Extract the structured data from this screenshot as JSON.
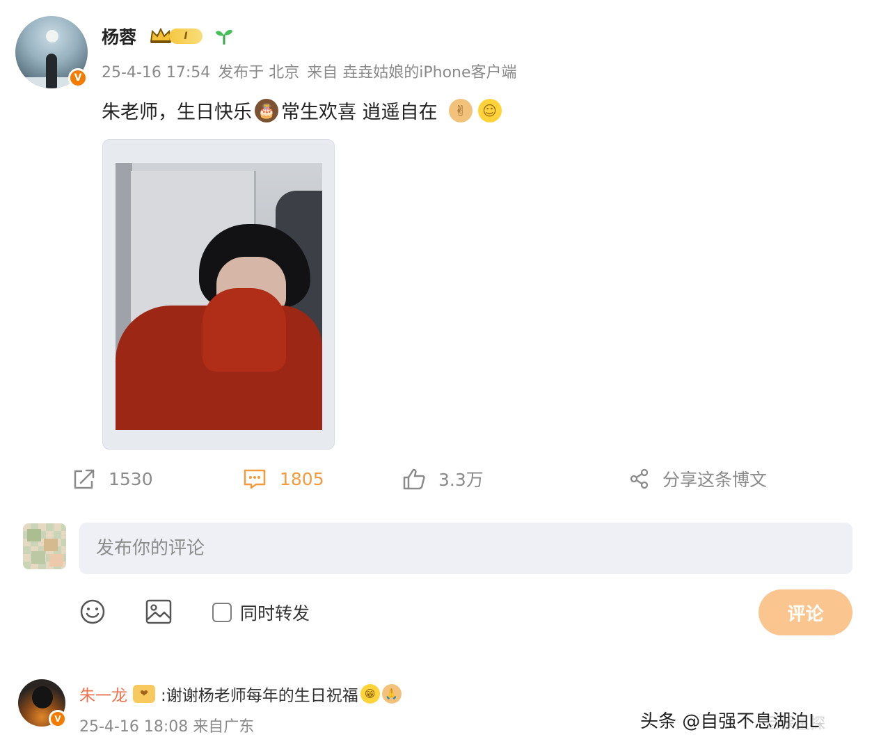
{
  "post": {
    "author": "杨蓉",
    "vip_level": "I",
    "timestamp": "25-4-16 17:54",
    "location": "发布于 北京",
    "source": "来自 垚垚姑娘的iPhone客户端",
    "text_part1": "朱老师，生日快乐",
    "text_part2": "常生欢喜 逍遥自在",
    "emoji_cake": "🎂",
    "emoji_victory": "✌",
    "emoji_smile": "☺"
  },
  "actions": {
    "repost_count": "1530",
    "comment_count": "1805",
    "like_count": "3.3万",
    "share_label": "分享这条博文"
  },
  "composer": {
    "placeholder": "发布你的评论",
    "repost_label": "同时转发",
    "submit_label": "评论"
  },
  "reply": {
    "author": "朱一龙",
    "badge_icon": "❤",
    "text": ":谢谢杨老师每年的生日祝福",
    "emoji1": "😁",
    "emoji2": "🙏",
    "timestamp": "25-4-16 18:08",
    "source": "来自广东"
  },
  "watermark": {
    "text": "头条 @自强不息湖泊L",
    "faint_text": "旦保星探"
  },
  "colors": {
    "accent_orange": "#f29a3c",
    "reply_name": "#eb7350",
    "submit_button": "#fbc58f",
    "input_bg": "#eef0f5"
  }
}
